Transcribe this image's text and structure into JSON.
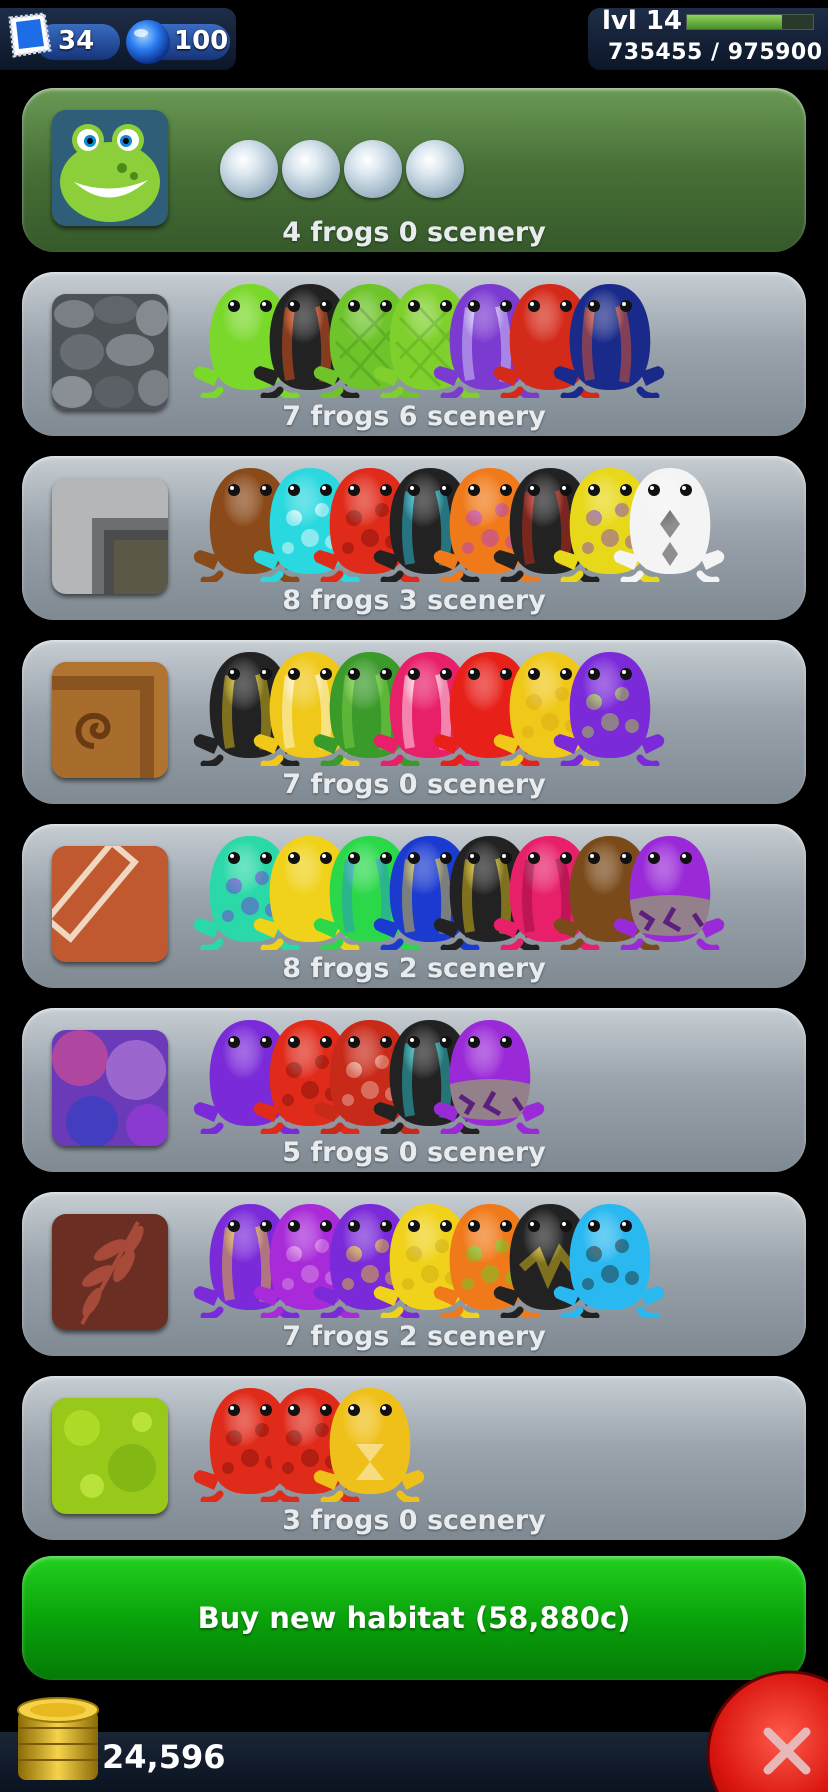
{
  "currency": {
    "stamps": "34",
    "gems": "100"
  },
  "player": {
    "level_label": "lvl 14",
    "xp_text": "735455 / 975900",
    "xp_fraction": 0.754
  },
  "habitats": [
    {
      "label": "4 frogs 0 scenery",
      "tile": "frog-portrait",
      "active": true,
      "bubbles": 4,
      "frogs": []
    },
    {
      "label": "7 frogs 6 scenery",
      "tile": "river-stones",
      "frogs": [
        [
          "#7ad82a",
          "#3c8a10",
          "none"
        ],
        [
          "#222",
          "#ff5a1a",
          "stripes"
        ],
        [
          "#6ec42a",
          "#2e7a12",
          "scales"
        ],
        [
          "#7fd02c",
          "#3a8a12",
          "scales"
        ],
        [
          "#7b3ad0",
          "#e0e0ff",
          "stripes"
        ],
        [
          "#d42a1a",
          "#7a1008",
          "none"
        ],
        [
          "#1a2a8a",
          "#ff5a1a",
          "stripes"
        ]
      ]
    },
    {
      "label": "8 frogs 3 scenery",
      "tile": "stone-block",
      "frogs": [
        [
          "#8a4a1a",
          "#5a2a08",
          "none"
        ],
        [
          "#2ad8e0",
          "#ffffff",
          "spots"
        ],
        [
          "#e02a1a",
          "#7a1008",
          "spots"
        ],
        [
          "#222",
          "#2ad8f0",
          "stripes"
        ],
        [
          "#f07a1a",
          "#b03ad8",
          "spots"
        ],
        [
          "#222",
          "#e02a1a",
          "stripes"
        ],
        [
          "#e8d81a",
          "#7a3ad0",
          "spots"
        ],
        [
          "#f4f4f4",
          "#111",
          "diamond"
        ]
      ]
    },
    {
      "label": "7 frogs 0 scenery",
      "tile": "carved-wood",
      "frogs": [
        [
          "#222",
          "#f0d21a",
          "stripes"
        ],
        [
          "#f0c81a",
          "#ffffff",
          "stripes"
        ],
        [
          "#3a9a2a",
          "#8ad84a",
          "stripes"
        ],
        [
          "#e8206a",
          "#ffffff",
          "stripes"
        ],
        [
          "#e8201a",
          "#ffffff",
          "none"
        ],
        [
          "#f0c81a",
          "#d8a810",
          "spots"
        ],
        [
          "#7a2ad8",
          "#a8e82a",
          "spots"
        ]
      ]
    },
    {
      "label": "8 frogs 2 scenery",
      "tile": "brick",
      "frogs": [
        [
          "#2ad8a8",
          "#7a2ad8",
          "spots"
        ],
        [
          "#f0d21a",
          "#7a2ad8",
          "none"
        ],
        [
          "#2ad84a",
          "#2a8ad8",
          "stripes"
        ],
        [
          "#1a3ad0",
          "#f0d21a",
          "stripes"
        ],
        [
          "#222",
          "#f0d21a",
          "stripes"
        ],
        [
          "#e8206a",
          "#8a0a3a",
          "stripes"
        ],
        [
          "#7a4a1a",
          "#4a2a08",
          "none"
        ],
        [
          "#9a2ad8",
          "#8ae82a",
          "mottled"
        ]
      ]
    },
    {
      "label": "5 frogs 0 scenery",
      "tile": "purple-watercolor",
      "frogs": [
        [
          "#7a2ad8",
          "#4a1a9a",
          "none"
        ],
        [
          "#e02a1a",
          "#7a1008",
          "spots"
        ],
        [
          "#c82a1a",
          "#f0c0b0",
          "spots"
        ],
        [
          "#222",
          "#2ad8e0",
          "stripes"
        ],
        [
          "#9a2ad8",
          "#8ae82a",
          "mottled"
        ]
      ]
    },
    {
      "label": "7 frogs 2 scenery",
      "tile": "leaf-pattern",
      "frogs": [
        [
          "#7a2ad8",
          "#f0d21a",
          "stripes"
        ],
        [
          "#a82ad8",
          "#e0a0e8",
          "spots"
        ],
        [
          "#7a2ad8",
          "#f0d21a",
          "spots"
        ],
        [
          "#f0d21a",
          "#c8a810",
          "spots"
        ],
        [
          "#f07a1a",
          "#5ad82a",
          "spots"
        ],
        [
          "#222",
          "#f0d21a",
          "zigzag"
        ],
        [
          "#2ab8f0",
          "#222",
          "spots"
        ]
      ]
    },
    {
      "label": "3 frogs 0 scenery",
      "tile": "green-moss",
      "frogs": [
        [
          "#e02a1a",
          "#7a1008",
          "spots"
        ],
        [
          "#e02a1a",
          "#7a1008",
          "spots"
        ],
        [
          "#f0c01a",
          "#ffffff",
          "hourglass"
        ]
      ]
    }
  ],
  "buy_button": {
    "label": "Buy new habitat (58,880c)"
  },
  "coins": {
    "amount": "24,596"
  }
}
